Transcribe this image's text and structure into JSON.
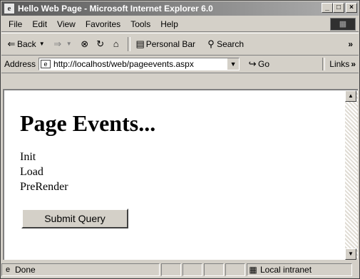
{
  "window": {
    "title": "Hello Web Page - Microsoft Internet Explorer 6.0"
  },
  "controls": {
    "minimize": "_",
    "maximize": "□",
    "close": "×"
  },
  "menu": {
    "items": [
      {
        "label": "File"
      },
      {
        "label": "Edit"
      },
      {
        "label": "View"
      },
      {
        "label": "Favorites"
      },
      {
        "label": "Tools"
      },
      {
        "label": "Help"
      }
    ]
  },
  "toolbar": {
    "back_label": "Back",
    "personal_bar_label": "Personal Bar",
    "search_label": "Search",
    "overflow": "»"
  },
  "address": {
    "label": "Address",
    "url": "http://localhost/web/pageevents.aspx",
    "go_label": "Go",
    "links_label": "Links",
    "links_overflow": "»"
  },
  "page": {
    "heading": "Page Events...",
    "events": [
      "Init",
      "Load",
      "PreRender"
    ],
    "submit_label": "Submit Query"
  },
  "status": {
    "text": "Done",
    "zone": "Local intranet"
  }
}
